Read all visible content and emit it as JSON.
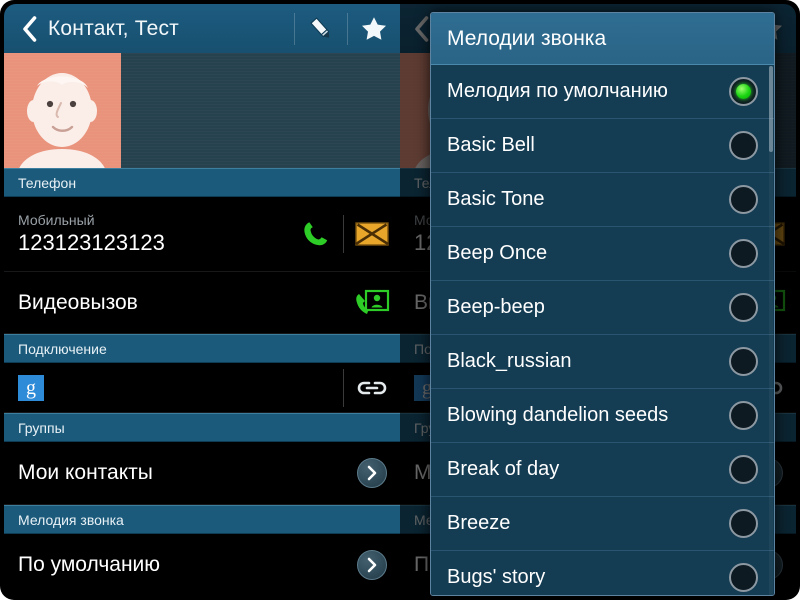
{
  "contact_screen": {
    "actionbar": {
      "back_icon": "chevron-left-icon",
      "title": "Контакт, Тест",
      "edit_icon": "pencil-icon",
      "favorite_icon": "star-icon"
    },
    "avatar": {
      "icon": "default-contact-avatar",
      "background_color": "#e9937c"
    },
    "sections": [
      {
        "header": "Телефон",
        "rows": [
          {
            "type": "phone-number",
            "label": "Мобильный",
            "value": "123123123123",
            "actions": [
              "call-icon",
              "message-icon"
            ]
          },
          {
            "type": "video-call",
            "title": "Видеовызов",
            "actions": [
              "video-call-icon"
            ]
          }
        ]
      },
      {
        "header": "Подключение",
        "rows": [
          {
            "type": "account",
            "account_icon": "google-icon",
            "account_letter": "g",
            "actions": [
              "link-icon"
            ]
          }
        ]
      },
      {
        "header": "Группы",
        "rows": [
          {
            "type": "group",
            "title": "Мои контакты",
            "actions": [
              "chevron-right-icon"
            ]
          }
        ]
      },
      {
        "header": "Мелодия звонка",
        "rows": [
          {
            "type": "ringtone",
            "title": "По умолчанию",
            "actions": [
              "chevron-right-icon"
            ]
          }
        ]
      }
    ]
  },
  "ringtone_dialog": {
    "title": "Мелодии звонка",
    "selected_index": 0,
    "items": [
      {
        "label": "Мелодия по умолчанию",
        "selected": true
      },
      {
        "label": "Basic Bell",
        "selected": false
      },
      {
        "label": "Basic Tone",
        "selected": false
      },
      {
        "label": "Beep Once",
        "selected": false
      },
      {
        "label": "Beep-beep",
        "selected": false
      },
      {
        "label": "Black_russian",
        "selected": false
      },
      {
        "label": "Blowing dandelion seeds",
        "selected": false
      },
      {
        "label": "Break of day",
        "selected": false
      },
      {
        "label": "Breeze",
        "selected": false
      },
      {
        "label": "Bugs' story",
        "selected": false
      }
    ],
    "scrollbar": {
      "visible": true
    }
  },
  "colors": {
    "actionbar": "#1d5b80",
    "section_header": "#1b5a7b",
    "list_background": "#000000",
    "dialog_background": "#143c53",
    "dialog_title": "#2f6d92",
    "selected_radio": "#19d411",
    "call_icon": "#2ecc26",
    "message_icon": "#e8a72b",
    "google_blue": "#2e8bd8"
  }
}
